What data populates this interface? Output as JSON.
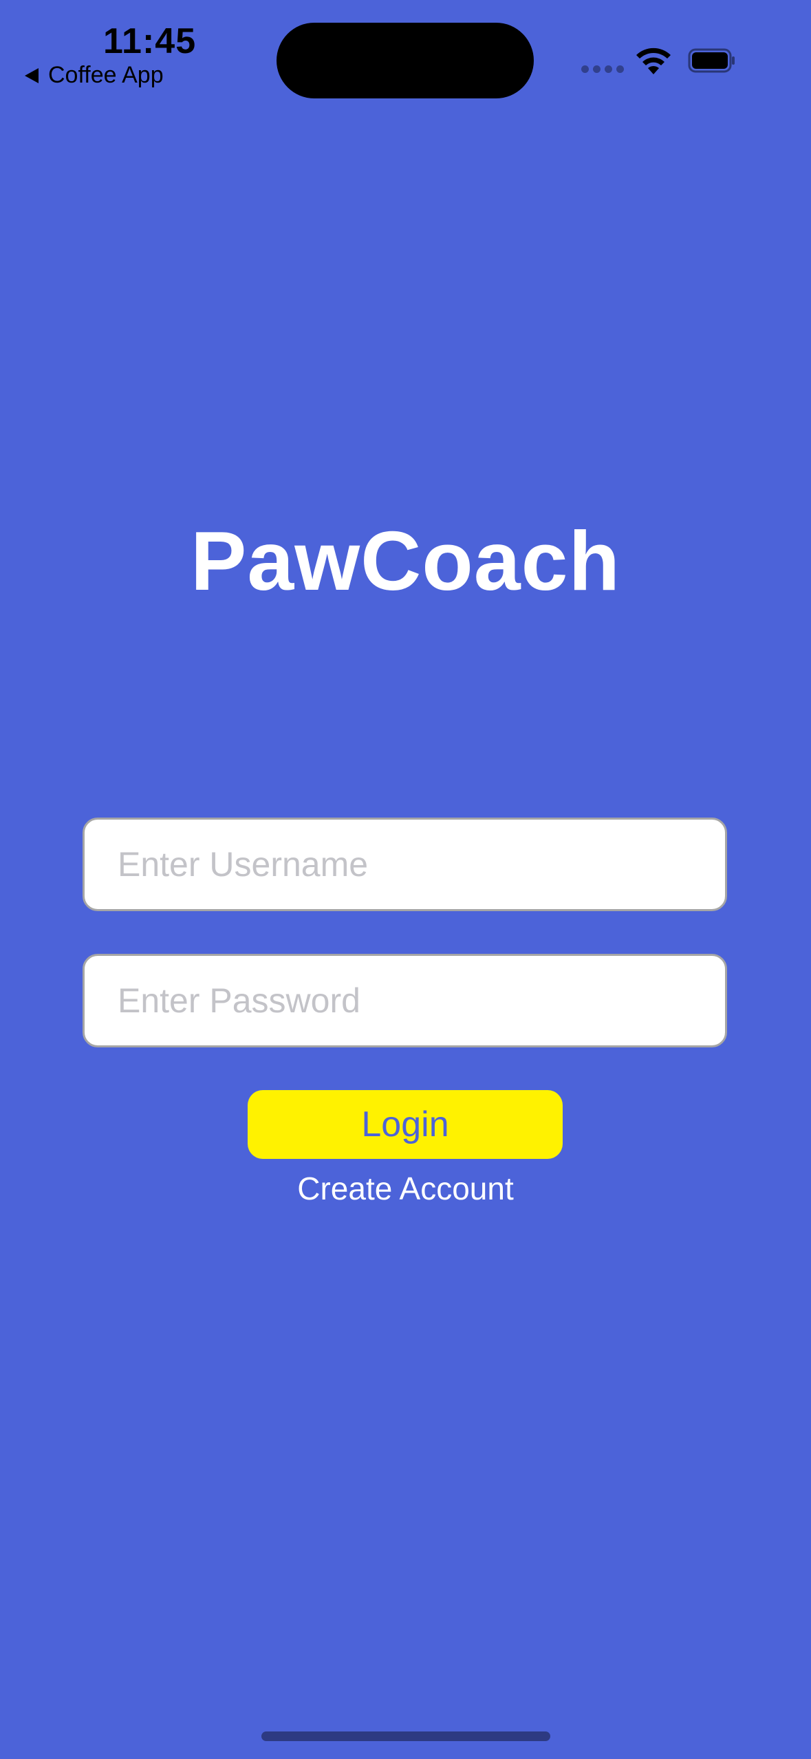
{
  "status_bar": {
    "time": "11:45",
    "back_label": "Coffee App"
  },
  "app": {
    "title": "PawCoach"
  },
  "form": {
    "username_placeholder": "Enter Username",
    "username_value": "",
    "password_placeholder": "Enter Password",
    "password_value": "",
    "login_label": "Login",
    "create_account_label": "Create Account"
  },
  "colors": {
    "background": "#4c63d9",
    "login_button": "#fff200",
    "login_text": "#4c63d9",
    "title_text": "#ffffff"
  },
  "icons": [
    "back-arrow-icon",
    "signal-icon",
    "wifi-icon",
    "battery-icon"
  ]
}
